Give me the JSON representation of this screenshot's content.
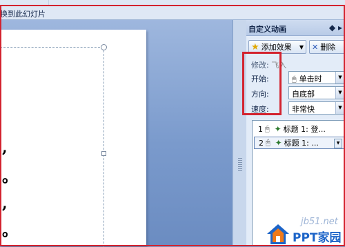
{
  "ribbon": {
    "button_label": "换到此幻灯片"
  },
  "slide": {
    "punctuation": [
      ",",
      "。",
      ",",
      "。"
    ]
  },
  "pane": {
    "title": "自定义动画",
    "nav_arrows": "◆ ▸",
    "add_effect_label": "添加效果",
    "delete_label": "删除",
    "modify_label": "修改:",
    "modify_value": "飞入",
    "start_label": "开始:",
    "start_value": "单击时",
    "direction_label": "方向:",
    "direction_value": "自底部",
    "speed_label": "速度:",
    "speed_value": "非常快",
    "items": [
      {
        "number": "1",
        "text": "标题 1: 登..."
      },
      {
        "number": "2",
        "text": "标题 1: ..."
      }
    ]
  },
  "watermark": {
    "url": "jb51.net",
    "brand": "PPT家园"
  },
  "colors": {
    "annotation_red": "#d3232f",
    "workspace_blue": "#7a9acc",
    "pane_bg": "#e3ecf8"
  }
}
